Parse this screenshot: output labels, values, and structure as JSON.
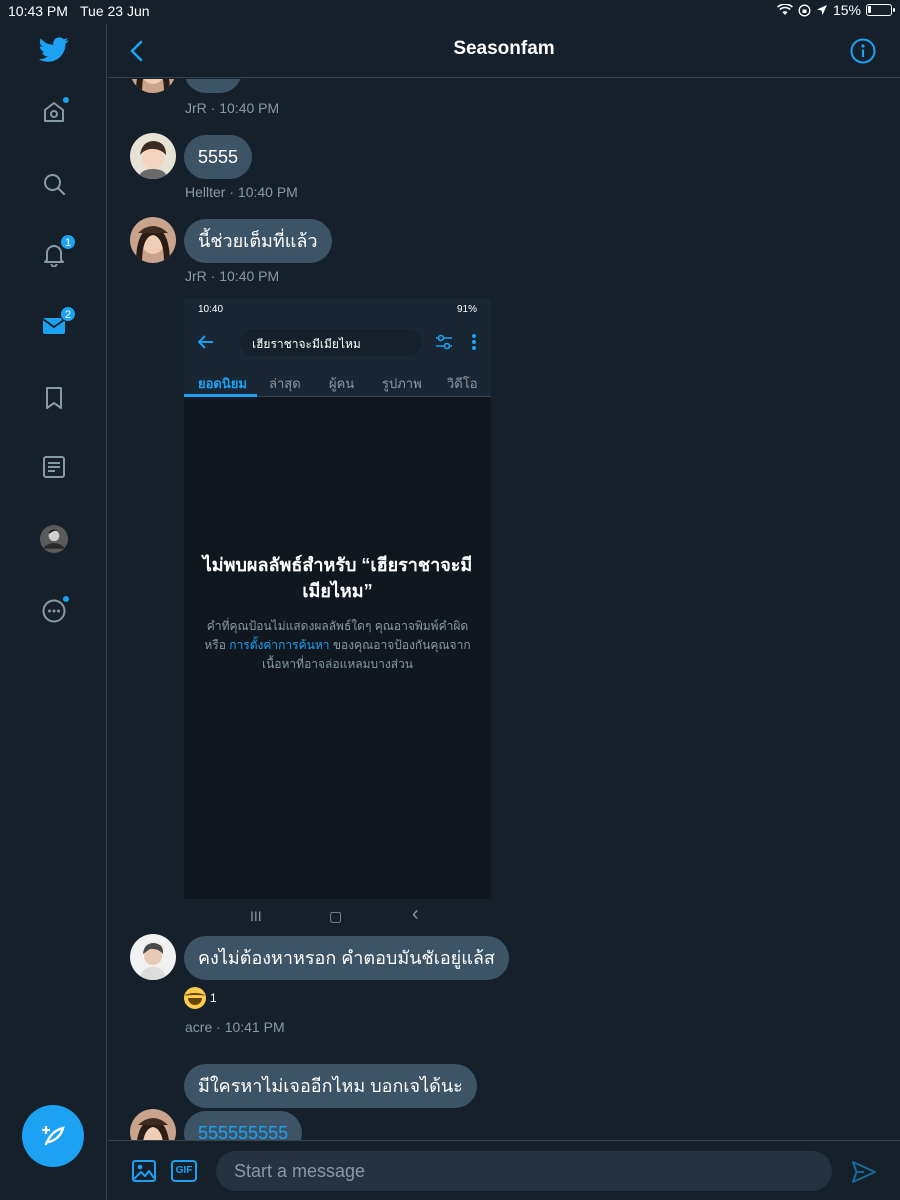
{
  "status_bar": {
    "time": "10:43 PM",
    "date": "Tue 23 Jun",
    "battery": "15%",
    "battery_level": 0.15
  },
  "sidebar": {
    "notifications_count": "1",
    "messages_count": "2"
  },
  "header": {
    "title": "Seasonfam"
  },
  "messages": [
    {
      "author": "JrR",
      "time": "10:40 PM",
      "text": "ไม่ง",
      "partial": true
    },
    {
      "author": "Hellter",
      "time": "10:40 PM",
      "text": "5555"
    },
    {
      "author": "JrR",
      "time": "10:40 PM",
      "text": "นี้ช่วยเต็มที่แล้ว"
    },
    {
      "author": "acre",
      "time": "10:41 PM",
      "text": "คงไม่ต้องหาหรอก คำตอบมันชัเอยู่แล้ส",
      "reaction": {
        "emoji": "face-with-tears-of-joy",
        "count": "1"
      }
    },
    {
      "text": "มีใครหาไม่เจออีกไหม บอกเจได้นะ"
    },
    {
      "text": "555555555",
      "is_link": true
    }
  ],
  "meta_separator": " · ",
  "embedded_screenshot": {
    "time": "10:40",
    "battery": "91%",
    "search_query": "เฮียราชาจะมีเมียไหม",
    "tabs": [
      "ยอดนิยม",
      "ล่าสุด",
      "ผู้คน",
      "รูปภาพ",
      "วิดีโอ"
    ],
    "active_tab": 0,
    "headline": "ไม่พบผลลัพธ์สำหรับ “เฮียราชาจะมีเมียไหม”",
    "desc_before": "คำที่คุณป้อนไม่แสดงผลลัพธ์ใดๆ คุณอาจพิมพ์คำผิด หรือ ",
    "desc_link": "การตั้งค่าการค้นหา",
    "desc_after": " ของคุณอาจป้องกันคุณจากเนื้อหาที่อาจล่อแหลมบางส่วน",
    "nav_buttons": [
      "III",
      "▢",
      "‹"
    ]
  },
  "composer": {
    "placeholder": "Start a message",
    "gif_label": "GIF"
  },
  "colors": {
    "background": "#15202b",
    "accent": "#1da1f2",
    "bubble": "#3d5466",
    "muted": "#8899a6",
    "divider": "#38444d"
  }
}
